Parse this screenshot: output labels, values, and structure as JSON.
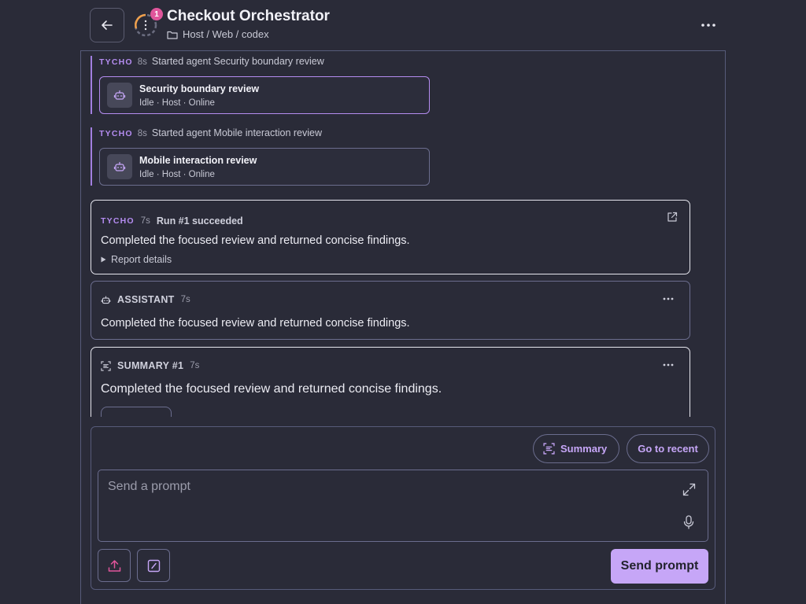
{
  "header": {
    "title": "Checkout Orchestrator",
    "badge_count": "1",
    "breadcrumb": "Host / Web / codex"
  },
  "feed": {
    "agent_events": [
      {
        "author": "TYCHO",
        "ago": "8s",
        "text": "Started agent Security boundary review",
        "card_title": "Security boundary review",
        "card_sub": "Idle · Host · Online"
      },
      {
        "author": "TYCHO",
        "ago": "8s",
        "text": "Started agent Mobile interaction review",
        "card_title": "Mobile interaction review",
        "card_sub": "Idle · Host · Online"
      }
    ],
    "run": {
      "author": "TYCHO",
      "ago": "7s",
      "title": "Run #1 succeeded",
      "body": "Completed the focused review and returned concise findings.",
      "details_label": "Report details"
    },
    "assistant": {
      "label": "ASSISTANT",
      "ago": "7s",
      "body": "Completed the focused review and returned concise findings."
    },
    "summary": {
      "label": "SUMMARY #1",
      "ago": "7s",
      "body": "Completed the focused review and returned concise findings."
    }
  },
  "composer": {
    "summary_label": "Summary",
    "recent_label": "Go to recent",
    "placeholder": "Send a prompt",
    "send_label": "Send prompt"
  },
  "colors": {
    "background": "#2a2b38",
    "accent": "#c6a6f7",
    "badge": "#e0559b",
    "author": "#b48cf0"
  }
}
